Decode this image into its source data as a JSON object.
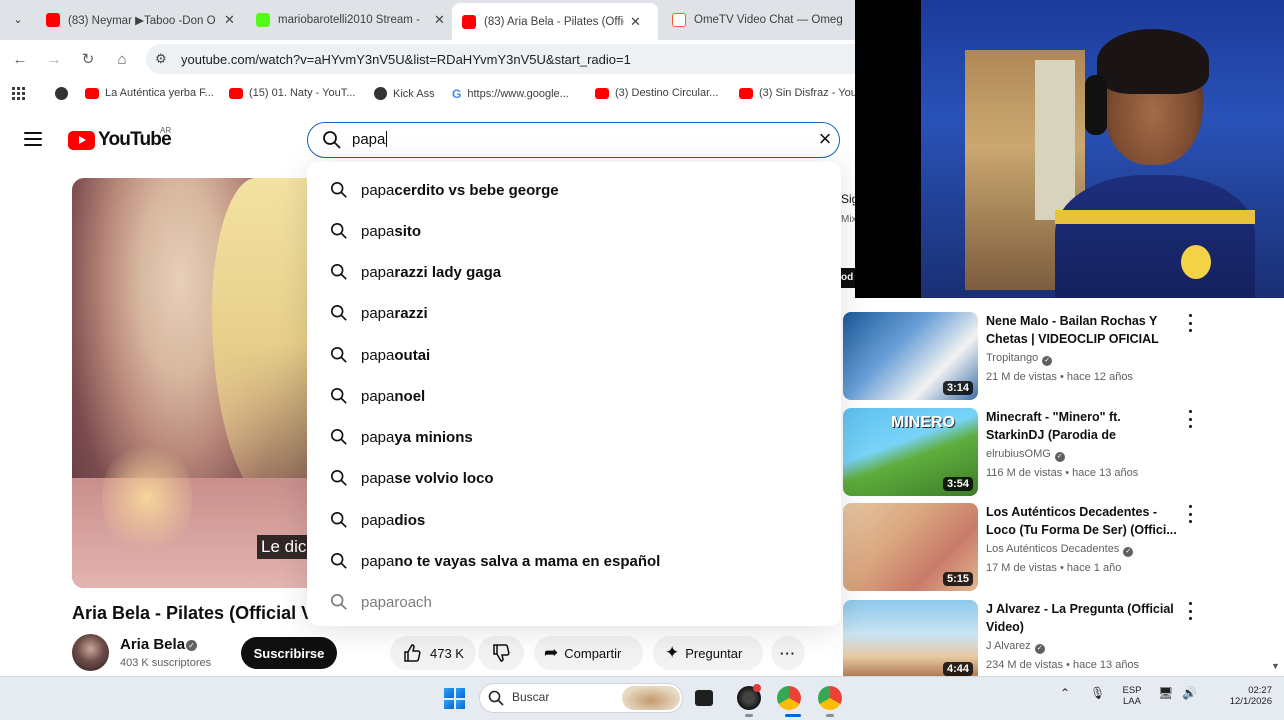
{
  "browser": {
    "tabs": [
      {
        "title": "(83) Neymar ▶Taboo -Don O",
        "favicon_color": "#ff0000",
        "active": false
      },
      {
        "title": "mariobarotelli2010 Stream -",
        "favicon_color": "#53fc18",
        "active": false
      },
      {
        "title": "(83) Aria Bela - Pilates (Offic",
        "favicon_color": "#ff0000",
        "active": true
      },
      {
        "title": "OmeTV Video Chat — Omeg",
        "favicon_color": "#f25c30",
        "active": false
      }
    ],
    "url": "youtube.com/watch?v=aHYvmY3nV5U&list=RDaHYvmY3nV5U&start_radio=1",
    "bookmarks": [
      {
        "label": "",
        "icon": "globe-icon"
      },
      {
        "label": "La Auténtica yerba F...",
        "icon": "youtube-icon"
      },
      {
        "label": "(15) 01. Naty - YouT...",
        "icon": "youtube-icon"
      },
      {
        "label": "Kick Ass",
        "icon": "globe-icon"
      },
      {
        "label": "https://www.google...",
        "icon": "google-icon"
      },
      {
        "label": "(3) Destino Circular...",
        "icon": "youtube-icon"
      },
      {
        "label": "(3) Sin Disfraz - You",
        "icon": "youtube-icon"
      }
    ]
  },
  "youtube": {
    "logo_text": "YouTube",
    "country": "AR",
    "search_value": "papa",
    "suggestions": [
      {
        "prefix": "papa",
        "rest": " cerdito vs bebe george"
      },
      {
        "prefix": "papa",
        "rest": "sito"
      },
      {
        "prefix": "papa",
        "rest": "razzi lady gaga"
      },
      {
        "prefix": "papa",
        "rest": "razzi"
      },
      {
        "prefix": "papa",
        "rest": "outai"
      },
      {
        "prefix": "papa",
        "rest": " noel"
      },
      {
        "prefix": "papa",
        "rest": "ya minions"
      },
      {
        "prefix": "papa",
        "rest": " se volvio loco"
      },
      {
        "prefix": "papa",
        "rest": " dios"
      },
      {
        "prefix": "papa",
        "rest": " no te vayas salva a mama en español"
      },
      {
        "prefix": "papa",
        "rest": " roach"
      }
    ],
    "video": {
      "caption": "Le dic",
      "title": "Aria Bela - Pilates (Official V",
      "channel": "Aria Bela",
      "subscribers": "403 K suscriptores",
      "subscribe_label": "Suscribirse",
      "likes": "473 K",
      "share_label": "Compartir",
      "ask_label": "Preguntar"
    },
    "right_partial": {
      "line1": "Sig",
      "line2": "Mix",
      "badge": "od"
    },
    "related": [
      {
        "title": "Nene Malo - Bailan Rochas Y Chetas | VIDEOCLIP OFICIAL HD",
        "channel": "Tropitango",
        "meta": "21 M de vistas • hace 12 años",
        "duration": "3:14"
      },
      {
        "title": "Minecraft - \"Minero\" ft. StarkinDJ (Parodia de \"Torero\"...",
        "channel": "elrubiusOMG",
        "meta": "116 M de vistas • hace 13 años",
        "duration": "3:54",
        "thumb_text": "MINERO"
      },
      {
        "title": "Los Auténticos Decadentes - Loco (Tu Forma De Ser) (Offici...",
        "channel": "Los Auténticos Decadentes",
        "meta": "17 M de vistas • hace 1 año",
        "duration": "5:15"
      },
      {
        "title": "J Alvarez - La Pregunta (Official Video)",
        "channel": "J Alvarez",
        "meta": "234 M de vistas • hace 13 años",
        "duration": "4:44"
      }
    ]
  },
  "taskbar": {
    "search_placeholder": "Buscar",
    "lang_top": "ESP",
    "lang_bottom": "LAA",
    "time": "02:27",
    "date": "12/1/2026"
  },
  "colors": {
    "accent": "#1c62b9",
    "youtube_red": "#ff0000",
    "tabstrip": "#dfe3e7"
  }
}
